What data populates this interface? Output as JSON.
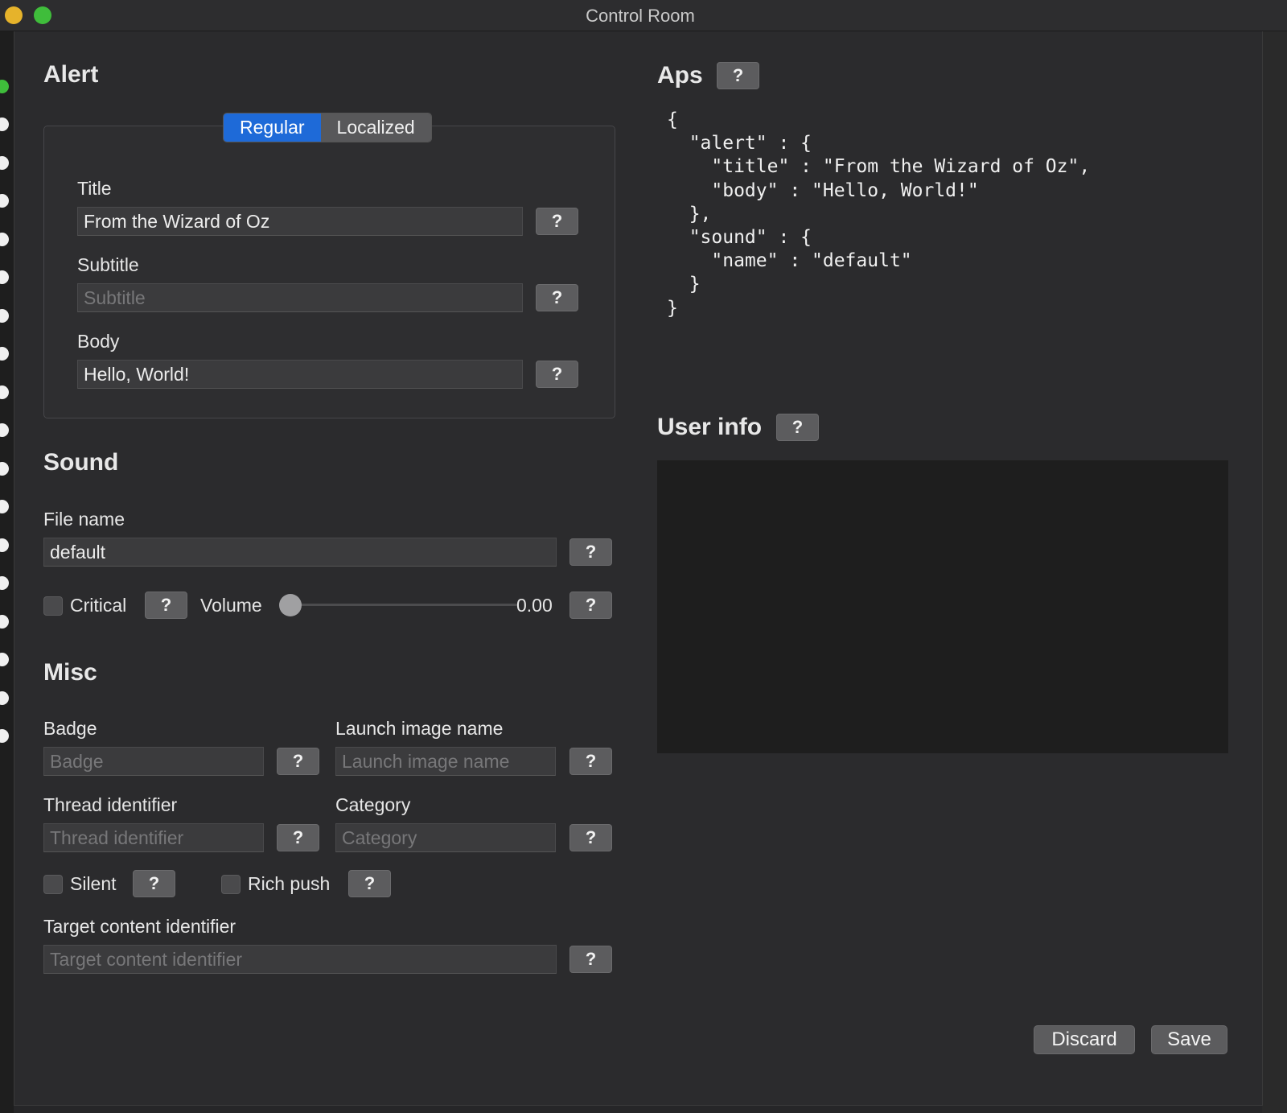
{
  "window": {
    "title": "Control Room"
  },
  "help_label": "?",
  "alert": {
    "heading": "Alert",
    "tabs": [
      "Regular",
      "Localized"
    ],
    "title_label": "Title",
    "title_value": "From the Wizard of Oz",
    "subtitle_label": "Subtitle",
    "subtitle_placeholder": "Subtitle",
    "body_label": "Body",
    "body_value": "Hello, World!"
  },
  "sound": {
    "heading": "Sound",
    "file_label": "File name",
    "file_value": "default",
    "critical_label": "Critical",
    "volume_label": "Volume",
    "volume_value": "0.00",
    "volume_level": 0.0
  },
  "misc": {
    "heading": "Misc",
    "badge_label": "Badge",
    "badge_placeholder": "Badge",
    "launch_label": "Launch image name",
    "launch_placeholder": "Launch image name",
    "thread_label": "Thread identifier",
    "thread_placeholder": "Thread identifier",
    "category_label": "Category",
    "category_placeholder": "Category",
    "silent_label": "Silent",
    "rich_label": "Rich push",
    "target_label": "Target content identifier",
    "target_placeholder": "Target content identifier"
  },
  "aps": {
    "heading": "Aps",
    "json": "{\n  \"alert\" : {\n    \"title\" : \"From the Wizard of Oz\",\n    \"body\" : \"Hello, World!\"\n  },\n  \"sound\" : {\n    \"name\" : \"default\"\n  }\n}"
  },
  "userinfo": {
    "heading": "User info"
  },
  "footer": {
    "discard_label": "Discard",
    "save_label": "Save"
  },
  "colors": {
    "accent": "#1e6ad8",
    "background": "#2b2b2d",
    "field": "#3b3b3d"
  }
}
